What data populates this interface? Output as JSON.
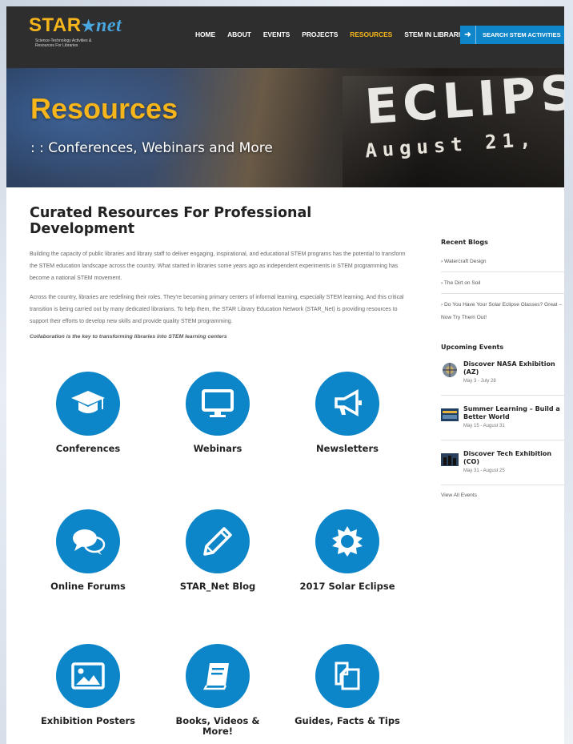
{
  "brand": {
    "name_part1": "STAR",
    "name_part2": "net",
    "tagline_line1": "Science-Technology Activities &",
    "tagline_line2": "Resources For Libraries"
  },
  "nav": {
    "items": [
      {
        "label": "HOME"
      },
      {
        "label": "ABOUT"
      },
      {
        "label": "EVENTS"
      },
      {
        "label": "PROJECTS"
      },
      {
        "label": "RESOURCES"
      },
      {
        "label": "STEM IN LIBRARIES"
      }
    ],
    "active": "RESOURCES",
    "search_label": "SEARCH STEM ACTIVITIES"
  },
  "hero": {
    "title": "Resources",
    "subtitle": ": : Conferences, Webinars and More",
    "bg_word": "ECLIPS",
    "bg_date": "August 21,"
  },
  "main": {
    "heading": "Curated Resources For Professional Development",
    "paragraph1": "Building the capacity of public libraries and library staff to deliver engaging, inspirational, and educational STEM programs has the potential to transform the STEM education landscape across the country. What started in libraries some years ago as independent experiments in STEM programming has become a national STEM movement.",
    "paragraph2": "Across the country, libraries are redefining their roles. They're becoming primary centers of informal learning, especially STEM learning. And this critical transition is being carried out by many dedicated librarians. To help them, the STAR Library Education Network (STAR_Net) is providing resources to support their efforts to develop new skills and provide quality STEM programming.",
    "tagline": "Collaboration is the key to transforming libraries into STEM learning centers"
  },
  "tiles": [
    {
      "label": "Conferences",
      "icon": "graduation-cap-icon"
    },
    {
      "label": "Webinars",
      "icon": "monitor-icon"
    },
    {
      "label": "Newsletters",
      "icon": "megaphone-icon"
    },
    {
      "label": "Online Forums",
      "icon": "chat-bubbles-icon"
    },
    {
      "label": "STAR_Net Blog",
      "icon": "pencil-icon"
    },
    {
      "label": "2017 Solar Eclipse",
      "icon": "sun-icon"
    },
    {
      "label": "Exhibition Posters",
      "icon": "image-icon"
    },
    {
      "label": "Books, Videos & More!",
      "icon": "book-icon"
    },
    {
      "label": "Guides, Facts & Tips",
      "icon": "documents-icon"
    }
  ],
  "sidebar": {
    "blogs_heading": "Recent Blogs",
    "blogs": [
      "› Watercraft Design",
      "› The Dirt on Soil",
      "› Do You Have Your Solar Eclipse Glasses? Great – Now Try Them Out!"
    ],
    "events_heading": "Upcoming Events",
    "events": [
      {
        "title": "Discover NASA Exhibition (AZ)",
        "dates": "May 3 - July 28"
      },
      {
        "title": "Summer Learning – Build a Better World",
        "dates": "May 15 - August 31"
      },
      {
        "title": "Discover Tech Exhibition (CO)",
        "dates": "May 31 - August 25"
      }
    ],
    "view_all": "View All Events"
  },
  "colors": {
    "accent_blue": "#0d86c9",
    "accent_gold": "#f5b51b",
    "header_bg": "#2e2e2e"
  }
}
